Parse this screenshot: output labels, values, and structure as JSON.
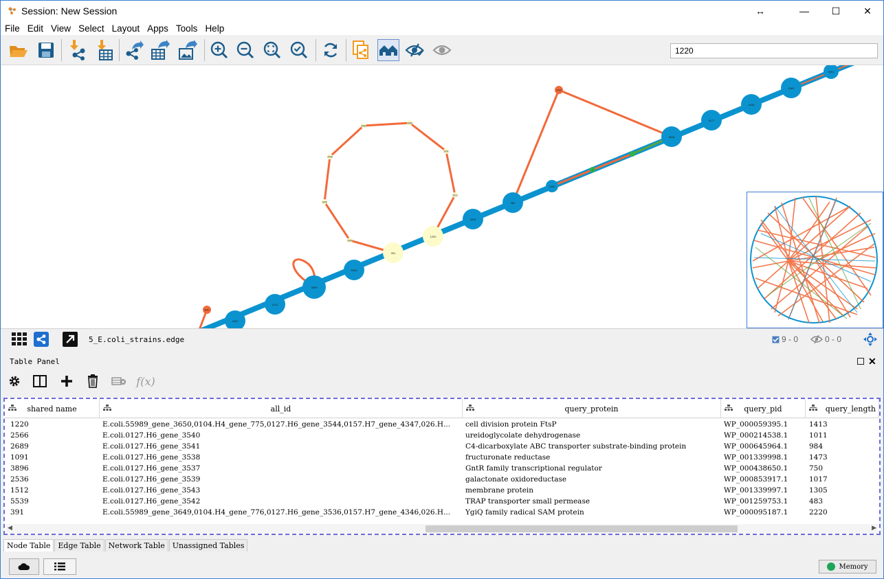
{
  "window": {
    "title": "Session: New Session",
    "controls": [
      "↔",
      "—",
      "☐",
      "✕"
    ]
  },
  "menu": [
    "File",
    "Edit",
    "View",
    "Select",
    "Layout",
    "Apps",
    "Tools",
    "Help"
  ],
  "toolbar": {
    "icons": [
      "open-session-icon",
      "save-session-icon",
      "import-network-icon",
      "import-table-icon",
      "export-network-icon",
      "export-table-icon",
      "export-image-icon",
      "zoom-in-icon",
      "zoom-out-icon",
      "zoom-fit-icon",
      "zoom-selected-icon",
      "refresh-icon",
      "first-neighbors-icon",
      "home-network-icon",
      "hide-selected-icon",
      "show-all-icon"
    ],
    "search_value": "1220"
  },
  "colors": {
    "node_blue": "#0b93cf",
    "node_orange": "#f26a3a",
    "node_yellow": "#fdfbc9",
    "node_green": "#2bb44a",
    "edge_blue": "#0b93cf",
    "edge_orange": "#f26a3a",
    "edge_green": "#5da33c",
    "accent": "#3b7fd4",
    "table_border": "#6c6cd8"
  },
  "network": {
    "nodes": [
      {
        "label": "1521",
        "color": "blue"
      },
      {
        "label": "1412",
        "color": "blue"
      },
      {
        "label": "3896",
        "color": "blue"
      },
      {
        "label": "5539",
        "color": "blue"
      },
      {
        "label": "391",
        "color": "yellow"
      },
      {
        "label": "1220",
        "color": "yellow"
      },
      {
        "label": "2878",
        "color": "blue"
      },
      {
        "label": "382",
        "color": "blue"
      },
      {
        "label": "1400",
        "color": "blue"
      },
      {
        "label": "3818",
        "color": "blue"
      },
      {
        "label": "3177",
        "color": "blue"
      },
      {
        "label": "4436",
        "color": "blue"
      },
      {
        "label": "2362",
        "color": "blue"
      },
      {
        "label": "3001",
        "color": "blue"
      },
      {
        "label": "2936",
        "color": "orange"
      },
      {
        "label": "3067",
        "color": "orange"
      },
      {
        "label": "2566",
        "color": "yellow"
      },
      {
        "label": "2689",
        "color": "yellow"
      },
      {
        "label": "1091",
        "color": "yellow"
      },
      {
        "label": "1512",
        "color": "yellow"
      },
      {
        "label": "2536",
        "color": "yellow"
      },
      {
        "label": "2066",
        "color": "yellow"
      },
      {
        "label": "1905",
        "color": "yellow"
      },
      {
        "label": "1",
        "color": "green"
      },
      {
        "label": "",
        "color": "green"
      }
    ],
    "name": "5_E.coli_strains.edge",
    "selected_counts": {
      "nodes": "9 - 0",
      "edges": "0 - 0"
    }
  },
  "table_panel": {
    "title": "Table Panel",
    "columns": [
      "shared name",
      "all_id",
      "query_protein",
      "query_pid",
      "query_length"
    ],
    "rows": [
      [
        "1220",
        "E.coli.55989_gene_3650,0104.H4_gene_775,0127.H6_gene_3544,0157.H7_gene_4347,026.H...",
        "cell division protein FtsP",
        "WP_000059395.1",
        "1413"
      ],
      [
        "2566",
        "E.coli.0127.H6_gene_3540",
        "ureidoglycolate dehydrogenase",
        "WP_000214538.1",
        "1011"
      ],
      [
        "2689",
        "E.coli.0127.H6_gene_3541",
        "C4-dicarboxylate ABC transporter substrate-binding protein",
        "WP_000645964.1",
        "984"
      ],
      [
        "1091",
        "E.coli.0127.H6_gene_3538",
        "fructuronate reductase",
        "WP_001339998.1",
        "1473"
      ],
      [
        "3896",
        "E.coli.0127.H6_gene_3537",
        "GntR family transcriptional regulator",
        "WP_000438650.1",
        "750"
      ],
      [
        "2536",
        "E.coli.0127.H6_gene_3539",
        "galactonate oxidoreductase",
        "WP_000853917.1",
        "1017"
      ],
      [
        "1512",
        "E.coli.0127.H6_gene_3543",
        "membrane protein",
        "WP_001339997.1",
        "1305"
      ],
      [
        "5539",
        "E.coli.0127.H6_gene_3542",
        "TRAP transporter small permease",
        "WP_001259753.1",
        "483"
      ],
      [
        "391",
        "E.coli.55989_gene_3649,0104.H4_gene_776,0127.H6_gene_3536,0157.H7_gene_4346,026.H...",
        "YgiQ family radical SAM protein",
        "WP_000095187.1",
        "2220"
      ]
    ],
    "tabs": [
      "Node Table",
      "Edge Table",
      "Network Table",
      "Unassigned Tables"
    ],
    "active_tab": "Node Table",
    "fx_label": "f(x)"
  },
  "status": {
    "memory_label": "Memory"
  }
}
